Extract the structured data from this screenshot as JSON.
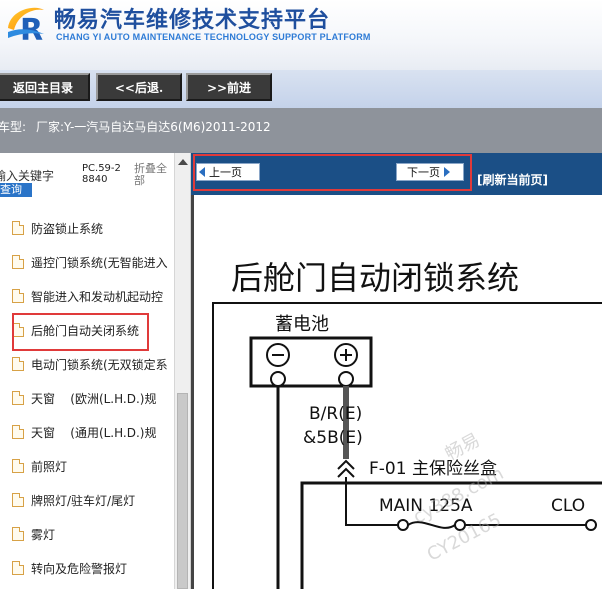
{
  "header": {
    "brand_cn": "畅易汽车维修技术支持平台",
    "brand_en": "CHANG YI AUTO MAINTENANCE TECHNOLOGY SUPPORT PLATFORM"
  },
  "nav": {
    "home": "返回主目录",
    "back": "<<后退.",
    "forward": ">>前进"
  },
  "vehicle": {
    "label": "车型:",
    "value": "厂家:Y-一汽马自达马自达6(M6)2011-2012"
  },
  "sidebar": {
    "keyword_label": "输入关键字",
    "search_button": "查询",
    "pc_code": "PC.59-28840",
    "collapse_all": "折叠全部",
    "items": [
      {
        "label": "防盗锁止系统"
      },
      {
        "label": "遥控门锁系统(无智能进入"
      },
      {
        "label": "智能进入和发动机起动控"
      },
      {
        "label": "后舱门自动关闭系统"
      },
      {
        "label": "电动门锁系统(无双锁定系"
      },
      {
        "label": "天窗    (欧洲(L.H.D.)规"
      },
      {
        "label": "天窗    (通用(L.H.D.)规"
      },
      {
        "label": "前照灯"
      },
      {
        "label": "牌照灯/驻车灯/尾灯"
      },
      {
        "label": "雾灯"
      },
      {
        "label": "转向及危险警报灯"
      }
    ]
  },
  "pager": {
    "prev": "上一页",
    "next": "下一页",
    "refresh": "[刷新当前页]"
  },
  "diagram": {
    "title": "后舱门自动闭锁系统",
    "battery": "蓄电池",
    "wire_code_1": "B/R(E)",
    "wire_code_2": "&5B(E)",
    "fuse_box": "F-01 主保险丝盒",
    "main_fuse": "MAIN 125A",
    "clo": "CLO"
  },
  "watermark": {
    "line1": "畅易",
    "line2": "cy388.com",
    "line3": "CY20165"
  },
  "colors": {
    "brand_blue": "#1f4f9e",
    "content_bar": "#1b4f86",
    "highlight_red": "#e03a3a",
    "vehicle_row": "#8e939b"
  }
}
